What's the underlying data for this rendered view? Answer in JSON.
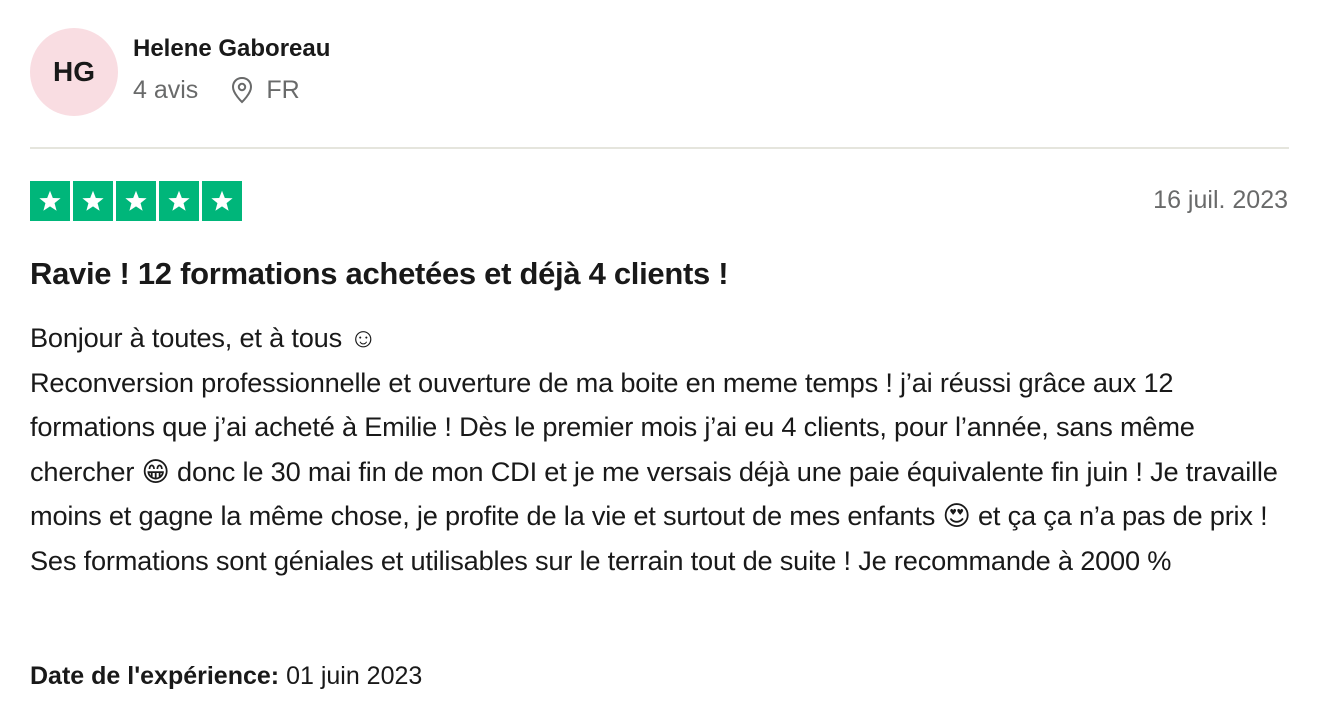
{
  "reviewer": {
    "initials": "HG",
    "name": "Helene Gaboreau",
    "review_count": "4 avis",
    "country": "FR",
    "location_icon": "map-pin-icon"
  },
  "rating": {
    "stars": 5,
    "max_stars": 5,
    "star_color": "#00b67a",
    "star_icon": "star-icon"
  },
  "review": {
    "date": "16 juil. 2023",
    "title": "Ravie ! 12 formations achetées et déjà 4 clients !",
    "greeting": "Bonjour à toutes, et à tous ☺",
    "body": "Reconversion professionnelle et ouverture de ma boite en meme temps ! j’ai réussi grâce aux 12 formations que j’ai acheté à Emilie ! Dès le premier mois j’ai eu 4 clients, pour l’année, sans même chercher 😁 donc le 30 mai fin de mon CDI et je me versais déjà une paie équivalente fin juin ! Je travaille moins et gagne la même chose, je profite de la vie et surtout de mes enfants 😍 et ça ça n’a pas de prix ! Ses formations sont géniales et utilisables sur le terrain tout de suite ! Je recommande à 2000 %"
  },
  "experience": {
    "label": "Date de l'expérience:",
    "date": "01 juin 2023"
  },
  "colors": {
    "avatar_bg": "#f9dde2",
    "divider": "#e5e5dd",
    "muted_text": "#696a6a"
  }
}
